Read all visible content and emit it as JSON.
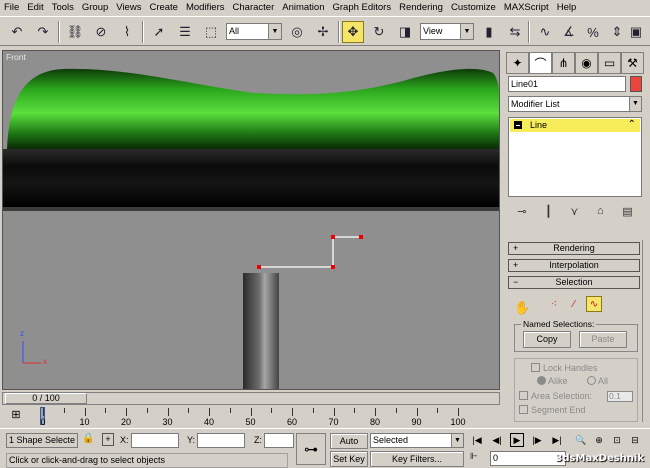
{
  "menu": [
    "File",
    "Edit",
    "Tools",
    "Group",
    "Views",
    "Create",
    "Modifiers",
    "Character",
    "Animation",
    "Graph Editors",
    "Rendering",
    "Customize",
    "MAXScript",
    "Help"
  ],
  "toolbar": {
    "selection_filter": "All",
    "reference_coord": "View"
  },
  "viewport": {
    "label": "Front",
    "axis_x": "x",
    "axis_z": "z"
  },
  "command_panel": {
    "object_name": "Line01",
    "object_color": "#e8463f",
    "modifier_list": "Modifier List",
    "stack_item": "Line",
    "rollouts": {
      "rendering": "Rendering",
      "interpolation": "Interpolation",
      "selection": "Selection"
    },
    "named_selections_label": "Named Selections:",
    "copy_label": "Copy",
    "paste_label": "Paste",
    "lock_handles": "Lock Handles",
    "alike": "Alike",
    "all": "All",
    "area_selection": "Area Selection:",
    "area_value": "0.1",
    "segment_end": "Segment End"
  },
  "timeline": {
    "frame_display": "0 / 100",
    "ticks": [
      "0",
      "10",
      "20",
      "30",
      "40",
      "50",
      "60",
      "70",
      "80",
      "90",
      "100"
    ]
  },
  "status": {
    "selection_count": "1 Shape Selecte",
    "x_label": "X:",
    "y_label": "Y:",
    "z_label": "Z:",
    "prompt": "Click or click-and-drag to select objects",
    "auto_key": "Auto Key",
    "set_key": "Set Key",
    "key_mode": "Selected",
    "key_filters": "Key Filters...",
    "current_frame": "0"
  },
  "watermark": "3dsMaxDeshnik"
}
